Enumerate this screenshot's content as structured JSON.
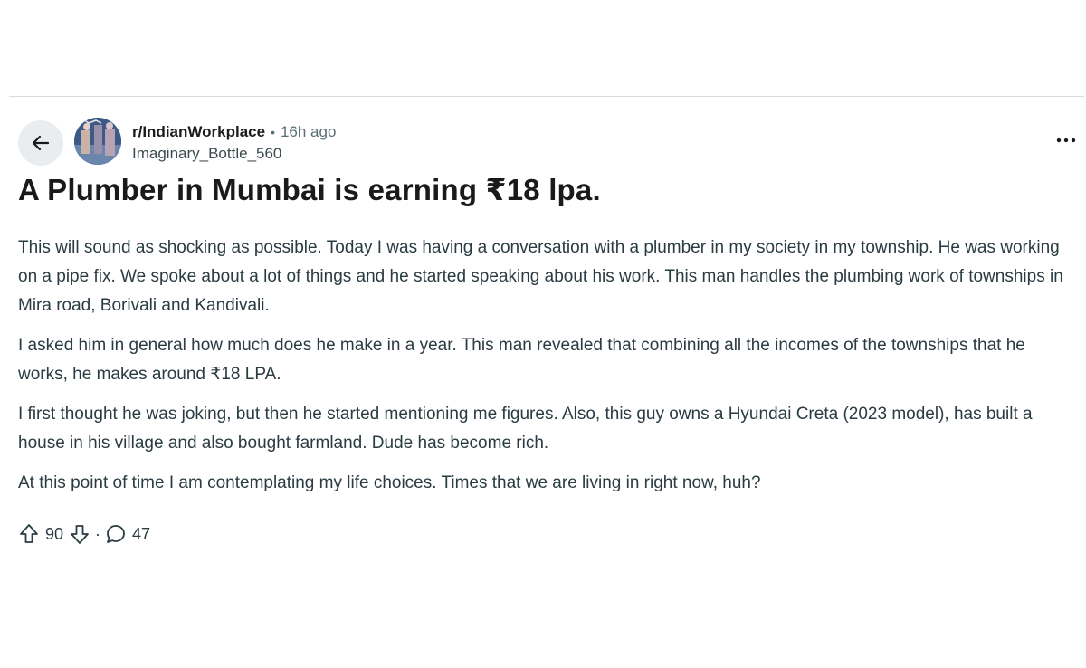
{
  "post": {
    "subreddit": "r/IndianWorkplace",
    "separator": "•",
    "time_ago": "16h ago",
    "author": "Imaginary_Bottle_560",
    "title": "A Plumber in Mumbai is earning ₹18 lpa.",
    "paragraphs": [
      "This will sound as shocking as possible. Today I was having a conversation with a plumber in my society in my township. He was working on a pipe fix. We spoke about a lot of things and he started speaking about his work. This man handles the plumbing work of townships in Mira road, Borivali and Kandivali.",
      "I asked him in general how much does he make in a year. This man revealed that combining all the incomes of the townships that he works, he makes around ₹18 LPA.",
      "I first thought he was joking, but then he started mentioning me figures. Also, this guy owns a Hyundai Creta (2023 model), has built a house in his village and also bought farmland. Dude has become rich.",
      "At this point of time I am contemplating my life choices. Times that we are living in right now, huh?"
    ],
    "upvotes": "90",
    "dot": "·",
    "comments": "47"
  },
  "icons": {
    "back": "arrow-left-icon",
    "menu": "more-horizontal-icon",
    "upvote": "upvote-arrow-icon",
    "downvote": "downvote-arrow-icon",
    "comment": "comment-bubble-icon"
  },
  "colors": {
    "back_button_bg": "#eaedef",
    "meta_text": "#576f76",
    "body_text": "#2a3c42",
    "divider": "#d9dcde"
  }
}
